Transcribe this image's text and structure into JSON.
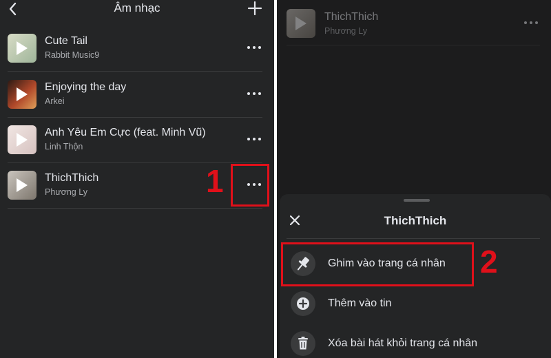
{
  "left": {
    "header": {
      "title": "Âm nhạc",
      "back_icon": "chevron-left-icon",
      "add_icon": "plus-icon"
    },
    "songs": [
      {
        "title": "Cute Tail",
        "artist": "Rabbit Music9"
      },
      {
        "title": "Enjoying the day",
        "artist": "Arkei"
      },
      {
        "title": "Anh Yêu Em Cực (feat. Minh Vũ)",
        "artist": "Linh Thộn"
      },
      {
        "title": "ThichThich",
        "artist": "Phương Ly"
      }
    ],
    "step_label": "1"
  },
  "right": {
    "song": {
      "title": "ThichThich",
      "artist": "Phương Ly"
    },
    "sheet": {
      "title": "ThichThich",
      "options": [
        {
          "label": "Ghim vào trang cá nhân",
          "icon": "pin-icon"
        },
        {
          "label": "Thêm vào tin",
          "icon": "plus-circle-icon"
        },
        {
          "label": "Xóa bài hát khỏi trang cá nhân",
          "icon": "trash-icon"
        }
      ]
    },
    "step_label": "2"
  },
  "colors": {
    "annotation": "#e0101a",
    "background": "#242526",
    "text": "#e4e6eb"
  }
}
